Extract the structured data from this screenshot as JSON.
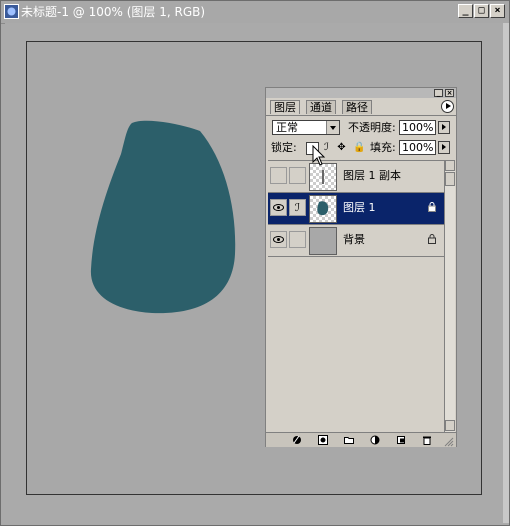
{
  "window": {
    "title": "未标题-1 @ 100% (图层 1, RGB)",
    "buttons": {
      "minimize": "_",
      "maximize": "□",
      "close": "×"
    }
  },
  "canvas": {
    "shape_color": "#2c5f6a",
    "background": "#a8a8a8"
  },
  "layers_panel": {
    "tabs": [
      "图层",
      "通道",
      "路径"
    ],
    "active_tab": "图层",
    "blend_mode": "正常",
    "opacity_label": "不透明度:",
    "opacity_value": "100%",
    "lock_label": "锁定:",
    "fill_label": "填充:",
    "fill_value": "100%",
    "layers": [
      {
        "name": "图层 1 副本",
        "visible": false,
        "selected": false
      },
      {
        "name": "图层 1",
        "visible": true,
        "selected": true
      },
      {
        "name": "背景",
        "visible": true,
        "selected": false
      }
    ],
    "bottom_icons": [
      "link-icon",
      "layer-style-icon",
      "mask-icon",
      "new-set-icon",
      "adjustment-layer-icon",
      "new-layer-icon",
      "trash-icon"
    ]
  },
  "colors": {
    "selection": "#0a246a",
    "panel": "#d4d0c8"
  }
}
